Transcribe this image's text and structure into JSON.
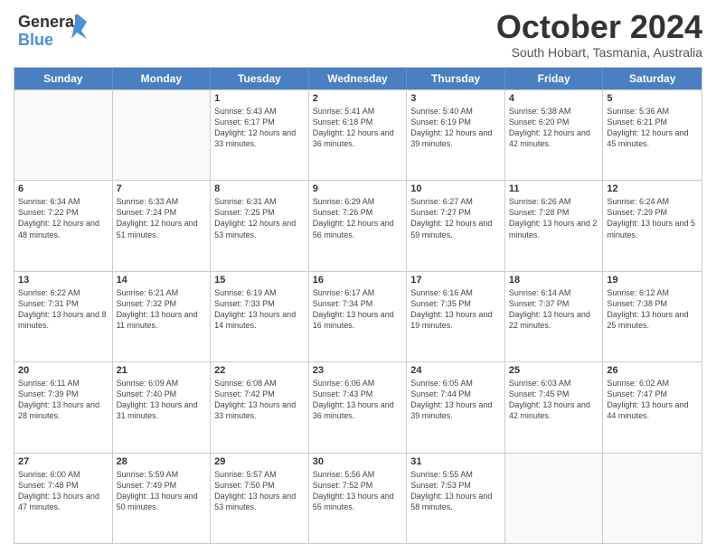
{
  "logo": {
    "line1": "General",
    "line2": "Blue"
  },
  "header": {
    "month": "October 2024",
    "location": "South Hobart, Tasmania, Australia"
  },
  "days_of_week": [
    "Sunday",
    "Monday",
    "Tuesday",
    "Wednesday",
    "Thursday",
    "Friday",
    "Saturday"
  ],
  "weeks": [
    [
      {
        "day": "",
        "empty": true
      },
      {
        "day": "",
        "empty": true
      },
      {
        "day": "1",
        "sunrise": "5:43 AM",
        "sunset": "6:17 PM",
        "daylight": "12 hours and 33 minutes."
      },
      {
        "day": "2",
        "sunrise": "5:41 AM",
        "sunset": "6:18 PM",
        "daylight": "12 hours and 36 minutes."
      },
      {
        "day": "3",
        "sunrise": "5:40 AM",
        "sunset": "6:19 PM",
        "daylight": "12 hours and 39 minutes."
      },
      {
        "day": "4",
        "sunrise": "5:38 AM",
        "sunset": "6:20 PM",
        "daylight": "12 hours and 42 minutes."
      },
      {
        "day": "5",
        "sunrise": "5:36 AM",
        "sunset": "6:21 PM",
        "daylight": "12 hours and 45 minutes."
      }
    ],
    [
      {
        "day": "6",
        "sunrise": "6:34 AM",
        "sunset": "7:22 PM",
        "daylight": "12 hours and 48 minutes."
      },
      {
        "day": "7",
        "sunrise": "6:33 AM",
        "sunset": "7:24 PM",
        "daylight": "12 hours and 51 minutes."
      },
      {
        "day": "8",
        "sunrise": "6:31 AM",
        "sunset": "7:25 PM",
        "daylight": "12 hours and 53 minutes."
      },
      {
        "day": "9",
        "sunrise": "6:29 AM",
        "sunset": "7:26 PM",
        "daylight": "12 hours and 56 minutes."
      },
      {
        "day": "10",
        "sunrise": "6:27 AM",
        "sunset": "7:27 PM",
        "daylight": "12 hours and 59 minutes."
      },
      {
        "day": "11",
        "sunrise": "6:26 AM",
        "sunset": "7:28 PM",
        "daylight": "13 hours and 2 minutes."
      },
      {
        "day": "12",
        "sunrise": "6:24 AM",
        "sunset": "7:29 PM",
        "daylight": "13 hours and 5 minutes."
      }
    ],
    [
      {
        "day": "13",
        "sunrise": "6:22 AM",
        "sunset": "7:31 PM",
        "daylight": "13 hours and 8 minutes."
      },
      {
        "day": "14",
        "sunrise": "6:21 AM",
        "sunset": "7:32 PM",
        "daylight": "13 hours and 11 minutes."
      },
      {
        "day": "15",
        "sunrise": "6:19 AM",
        "sunset": "7:33 PM",
        "daylight": "13 hours and 14 minutes."
      },
      {
        "day": "16",
        "sunrise": "6:17 AM",
        "sunset": "7:34 PM",
        "daylight": "13 hours and 16 minutes."
      },
      {
        "day": "17",
        "sunrise": "6:16 AM",
        "sunset": "7:35 PM",
        "daylight": "13 hours and 19 minutes."
      },
      {
        "day": "18",
        "sunrise": "6:14 AM",
        "sunset": "7:37 PM",
        "daylight": "13 hours and 22 minutes."
      },
      {
        "day": "19",
        "sunrise": "6:12 AM",
        "sunset": "7:38 PM",
        "daylight": "13 hours and 25 minutes."
      }
    ],
    [
      {
        "day": "20",
        "sunrise": "6:11 AM",
        "sunset": "7:39 PM",
        "daylight": "13 hours and 28 minutes."
      },
      {
        "day": "21",
        "sunrise": "6:09 AM",
        "sunset": "7:40 PM",
        "daylight": "13 hours and 31 minutes."
      },
      {
        "day": "22",
        "sunrise": "6:08 AM",
        "sunset": "7:42 PM",
        "daylight": "13 hours and 33 minutes."
      },
      {
        "day": "23",
        "sunrise": "6:06 AM",
        "sunset": "7:43 PM",
        "daylight": "13 hours and 36 minutes."
      },
      {
        "day": "24",
        "sunrise": "6:05 AM",
        "sunset": "7:44 PM",
        "daylight": "13 hours and 39 minutes."
      },
      {
        "day": "25",
        "sunrise": "6:03 AM",
        "sunset": "7:45 PM",
        "daylight": "13 hours and 42 minutes."
      },
      {
        "day": "26",
        "sunrise": "6:02 AM",
        "sunset": "7:47 PM",
        "daylight": "13 hours and 44 minutes."
      }
    ],
    [
      {
        "day": "27",
        "sunrise": "6:00 AM",
        "sunset": "7:48 PM",
        "daylight": "13 hours and 47 minutes."
      },
      {
        "day": "28",
        "sunrise": "5:59 AM",
        "sunset": "7:49 PM",
        "daylight": "13 hours and 50 minutes."
      },
      {
        "day": "29",
        "sunrise": "5:57 AM",
        "sunset": "7:50 PM",
        "daylight": "13 hours and 53 minutes."
      },
      {
        "day": "30",
        "sunrise": "5:56 AM",
        "sunset": "7:52 PM",
        "daylight": "13 hours and 55 minutes."
      },
      {
        "day": "31",
        "sunrise": "5:55 AM",
        "sunset": "7:53 PM",
        "daylight": "13 hours and 58 minutes."
      },
      {
        "day": "",
        "empty": true
      },
      {
        "day": "",
        "empty": true
      }
    ]
  ]
}
